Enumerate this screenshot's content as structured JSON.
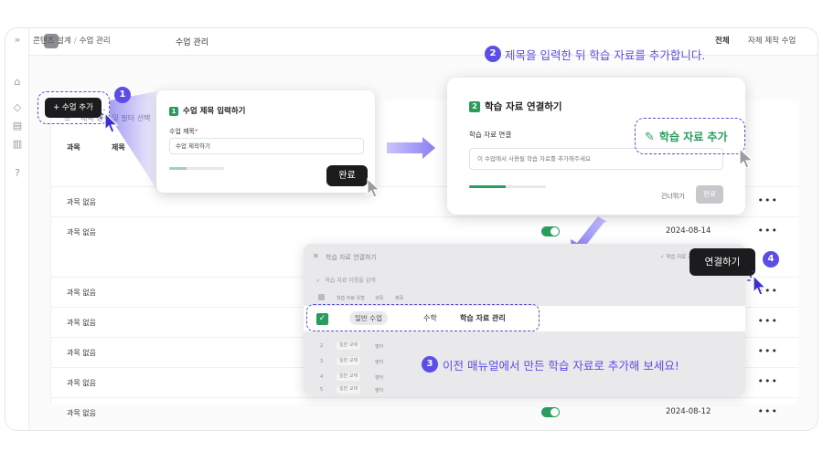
{
  "app": {
    "title": "수업 관리",
    "breadcrumb": {
      "root": "콘텐츠 설계",
      "sep": "/",
      "current": "수업 관리"
    },
    "tabs": {
      "all": "전체",
      "own": "자체 제작 수업"
    }
  },
  "toolbar": {
    "add_label": "+ 수업 추가"
  },
  "filter": {
    "placeholder": "제목 검색 및 필터 선택"
  },
  "table": {
    "headers": {
      "subject": "과목",
      "title": "제목"
    },
    "rows": [
      {
        "subject": "과목 없음",
        "date": "",
        "active": false
      },
      {
        "subject": "과목 없음",
        "date": "2024-08-14",
        "active": true
      },
      {
        "subject": "과목 없음",
        "date": "",
        "active": false
      },
      {
        "subject": "과목 없음",
        "date": "",
        "active": false
      },
      {
        "subject": "과목 없음",
        "date": "",
        "active": false
      },
      {
        "subject": "과목 없음",
        "date": "",
        "active": false
      },
      {
        "subject": "과목 없음",
        "date": "2024-08-12",
        "active": true
      }
    ],
    "more": "•••"
  },
  "step1": {
    "number": "1",
    "title": "수업 제목 입력하기",
    "field_label": "수업 제목",
    "required_mark": "*",
    "field_value": "수업 제작하기",
    "progress": 0.32,
    "done_label": "완료"
  },
  "step2": {
    "number": "2",
    "title": "학습 자료 연결하기",
    "field_label": "학습 자료 연결",
    "field_placeholder": "이 수업에서 사용될 학습 자료를 추가해주세요",
    "progress": 0.48,
    "skip_label": "건너뛰기",
    "ok_label": "완료",
    "add_material_label": "학습 자료 추가"
  },
  "step3": {
    "close": "✕",
    "title": "학습 자료 연결하기",
    "right_label": "✓ 학습 자료 관",
    "search_placeholder": "학습 자료 이름을 검색",
    "headers": {
      "type": "학습 자료 유형",
      "subject": "과목",
      "title": "제목"
    },
    "selected_row": {
      "type": "일반 수업",
      "subject": "수학",
      "title": "학습 자료 관리"
    },
    "rows": [
      {
        "n": "2",
        "type": "일반 교재",
        "subject": "영어"
      },
      {
        "n": "3",
        "type": "일반 교재",
        "subject": "영어"
      },
      {
        "n": "4",
        "type": "일반 교재",
        "subject": "영어"
      },
      {
        "n": "5",
        "type": "일반 교재",
        "subject": "영어"
      }
    ],
    "connect_label": "연결하기"
  },
  "callouts": {
    "badge1": "1",
    "badge2": "2",
    "badge3": "3",
    "badge4": "4",
    "text2": "제목을 입력한 뒤 학습 자료를 추가합니다.",
    "text3": "이전 매뉴얼에서 만든 학습 자료로 추가해 보세요!"
  },
  "colors": {
    "accent": "#5b4ee6",
    "green": "#2a9d5c",
    "dark_button": "#1c1c1e"
  },
  "icons": {
    "expand": "chevrons-right-icon",
    "home": "home-icon",
    "filter": "filter-icon",
    "pencil": "pencil-icon",
    "check": "checkmark-icon",
    "cursor": "cursor-click-icon"
  }
}
